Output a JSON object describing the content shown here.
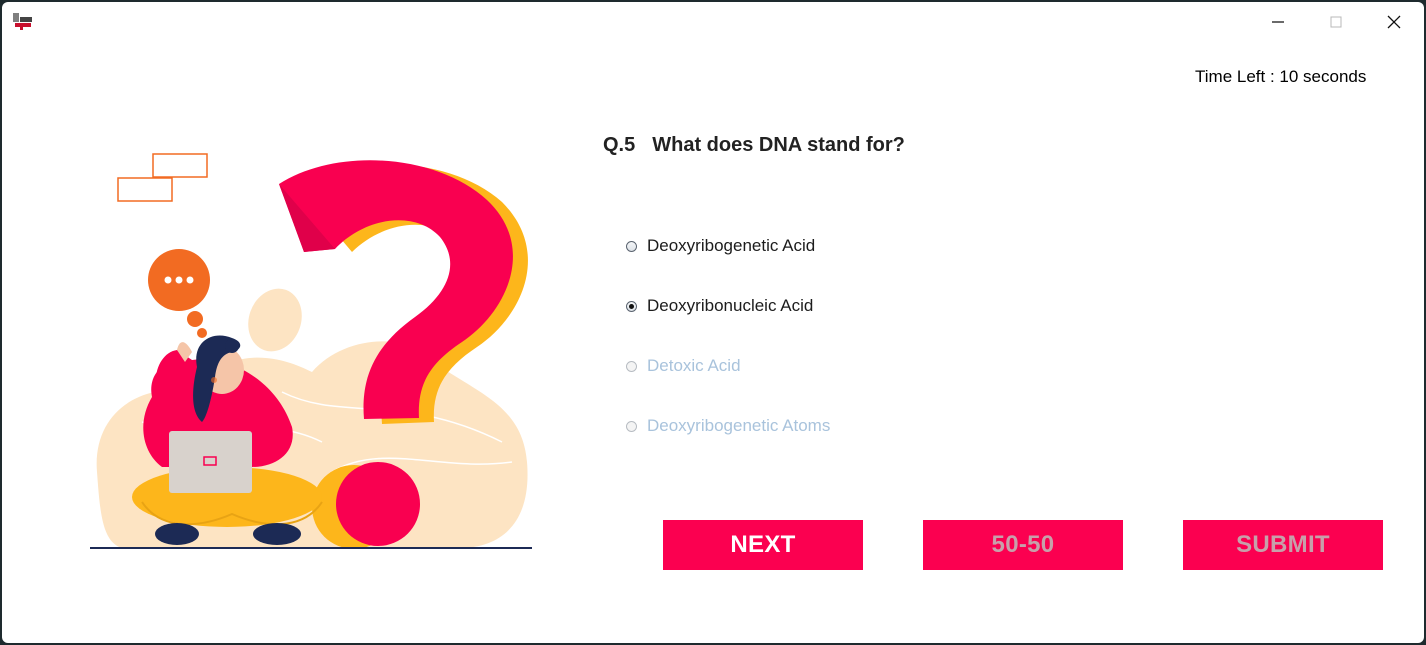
{
  "timer": {
    "label": "Time Left : ",
    "value": "10 seconds"
  },
  "question": {
    "number": "Q.5",
    "text": "What does DNA stand for?"
  },
  "options": [
    {
      "label": "Deoxyribogenetic Acid",
      "selected": false,
      "enabled": true
    },
    {
      "label": "Deoxyribonucleic Acid",
      "selected": true,
      "enabled": true
    },
    {
      "label": "Detoxic Acid",
      "selected": false,
      "enabled": false
    },
    {
      "label": "Deoxyribogenetic Atoms",
      "selected": false,
      "enabled": false
    }
  ],
  "buttons": {
    "next": "NEXT",
    "fifty_fifty": "50-50",
    "submit": "SUBMIT"
  },
  "colors": {
    "accent": "#fb0050",
    "question_mark": "#f90050",
    "question_mark_shadow": "#fdb61b",
    "disabled_option_text": "#a9c3dc",
    "disabled_button_text": "#c7a0aa"
  },
  "icons": {
    "app": "quiz-app-icon",
    "minimize": "minimize-icon",
    "maximize": "maximize-icon",
    "close": "close-icon"
  }
}
